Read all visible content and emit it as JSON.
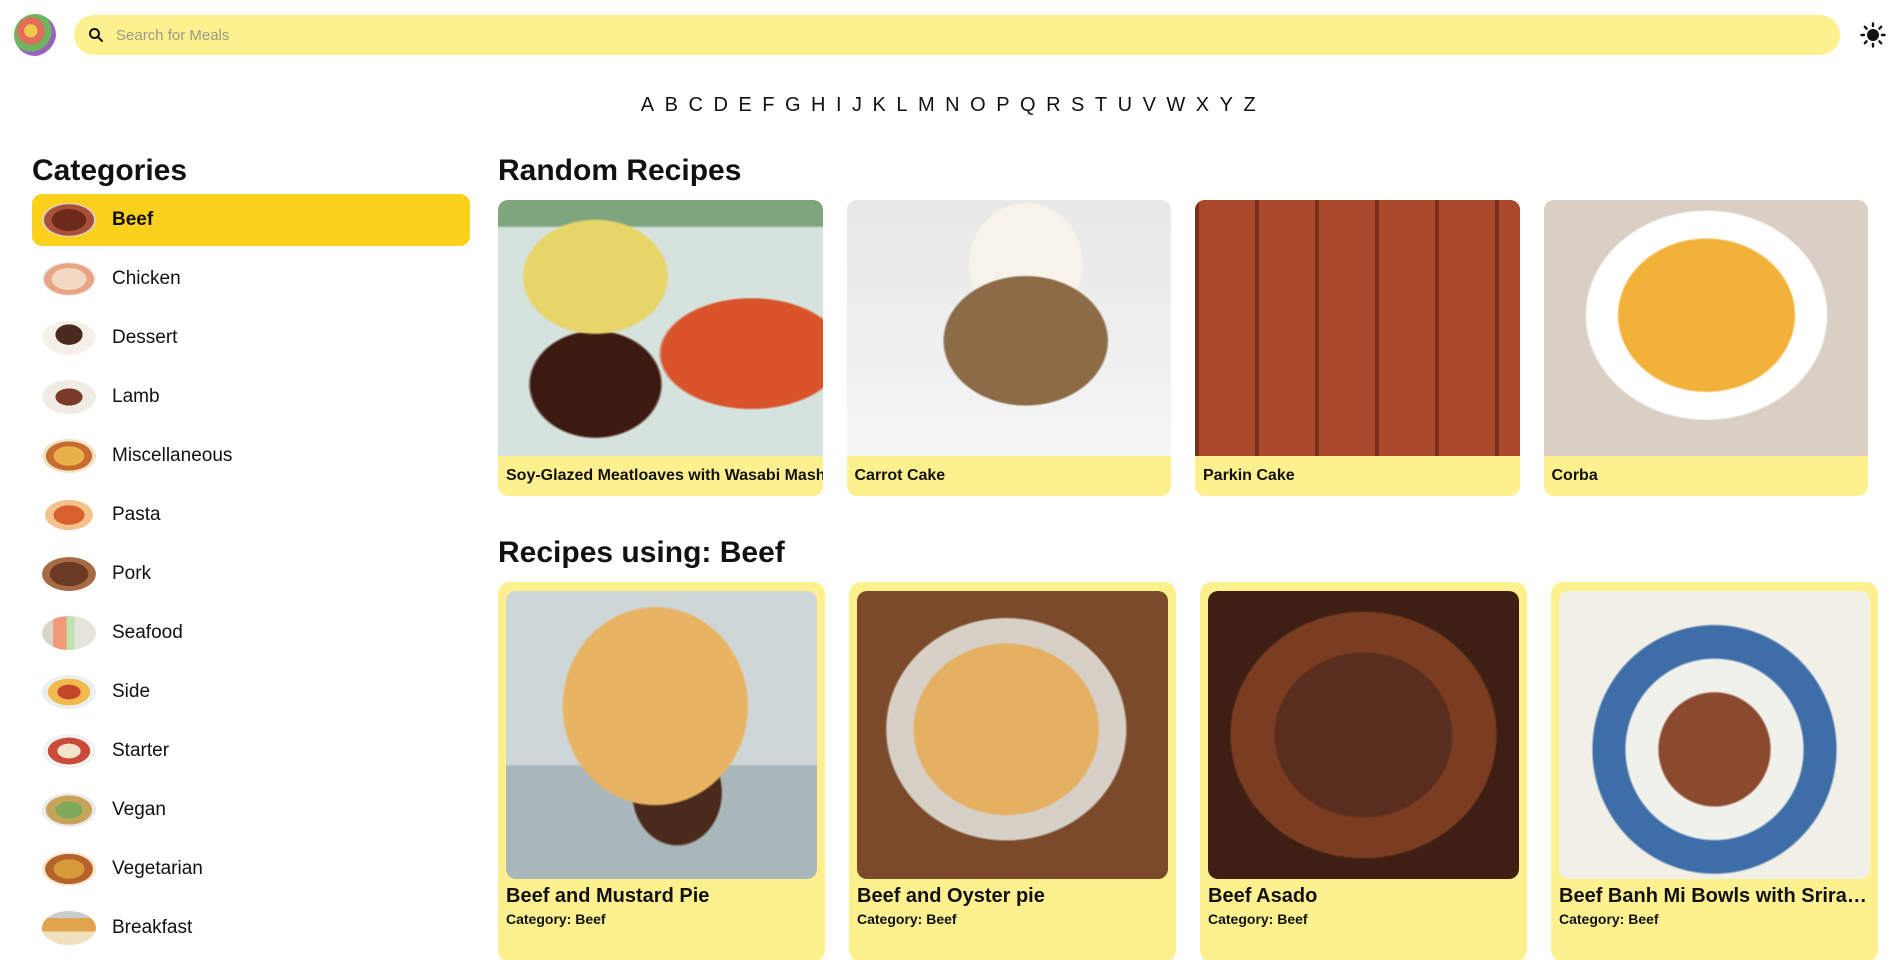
{
  "search": {
    "placeholder": "Search for Meals"
  },
  "alphabet": [
    "A",
    "B",
    "C",
    "D",
    "E",
    "F",
    "G",
    "H",
    "I",
    "J",
    "K",
    "L",
    "M",
    "N",
    "O",
    "P",
    "Q",
    "R",
    "S",
    "T",
    "U",
    "V",
    "W",
    "X",
    "Y",
    "Z"
  ],
  "sidebar": {
    "title": "Categories",
    "items": [
      {
        "label": "Beef",
        "active": true
      },
      {
        "label": "Chicken"
      },
      {
        "label": "Dessert"
      },
      {
        "label": "Lamb"
      },
      {
        "label": "Miscellaneous"
      },
      {
        "label": "Pasta"
      },
      {
        "label": "Pork"
      },
      {
        "label": "Seafood"
      },
      {
        "label": "Side"
      },
      {
        "label": "Starter"
      },
      {
        "label": "Vegan"
      },
      {
        "label": "Vegetarian"
      },
      {
        "label": "Breakfast"
      }
    ]
  },
  "random": {
    "title": "Random Recipes",
    "items": [
      {
        "name": "Soy-Glazed Meatloaves with Wasabi Mashed Potatoes & Roasted Carrots"
      },
      {
        "name": "Carrot Cake"
      },
      {
        "name": "Parkin Cake"
      },
      {
        "name": "Corba"
      }
    ]
  },
  "category_recipes": {
    "title": "Recipes using: Beef",
    "items": [
      {
        "name": "Beef and Mustard Pie",
        "category": "Category: Beef"
      },
      {
        "name": "Beef and Oyster pie",
        "category": "Category: Beef"
      },
      {
        "name": "Beef Asado",
        "category": "Category: Beef"
      },
      {
        "name": "Beef Banh Mi Bowls with Sriracha Mayo, Carrot & Pickled Cucumber",
        "category": "Category: Beef"
      }
    ]
  },
  "colors": {
    "accent": "#fbd11c",
    "card": "#fdf08e"
  }
}
